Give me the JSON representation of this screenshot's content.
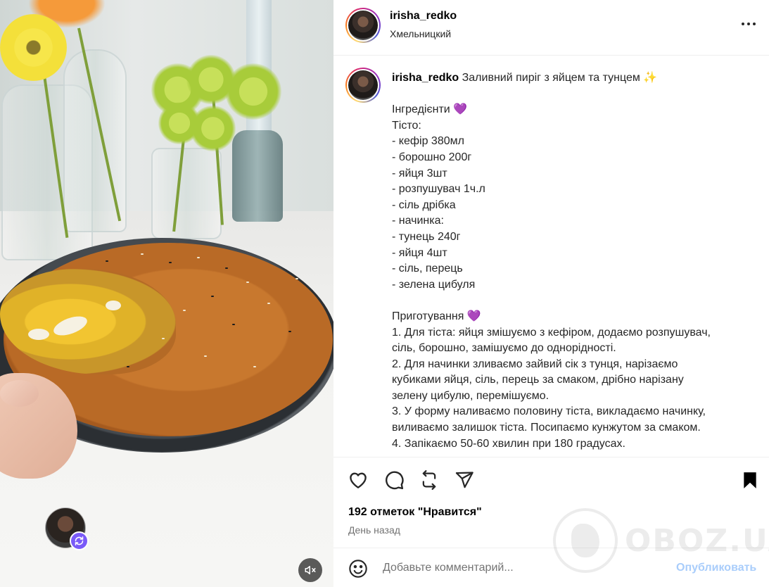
{
  "post": {
    "username": "irisha_redko",
    "location": "Хмельницкий"
  },
  "caption": {
    "username": "irisha_redko",
    "title": "Заливний пиріг з яйцем та тунцем ✨",
    "lines": [
      "Інгредієнти 💜",
      "Тісто:",
      "- кефір 380мл",
      "- борошно 200г",
      "- яйця 3шт",
      "- розпушувач 1ч.л",
      "- сіль дрібка",
      "- начинка:",
      "- тунець 240г",
      "- яйця 4шт",
      "- сіль, перець",
      "- зелена цибуля",
      "",
      "Приготування 💜",
      "1. Для тіста: яйця змішуємо з кефіром, додаємо розпушувач,",
      "сіль, борошно, замішуємо до однорідності.",
      "2. Для начинки зливаємо зайвий сік з тунця, нарізаємо",
      "кубиками яйця, сіль, перець за смаком, дрібно нарізану",
      "зелену цибулю, перемішуємо.",
      "3. У форму наливаємо половину тіста, викладаємо начинку,",
      "виливаємо залишок тіста. Посипаємо кунжутом за смаком.",
      "4. Запікаємо 50-60 хвилин при 180 градусах."
    ]
  },
  "stats": {
    "likes": "192 отметок \"Нравится\"",
    "time": "День назад"
  },
  "comment": {
    "placeholder": "Добавьте комментарий...",
    "publish_label": "Опубликовать"
  },
  "watermark": {
    "text": "OBOZ.UA"
  },
  "icons": {
    "like": "heart-icon",
    "comment": "comment-icon",
    "repost": "repost-icon",
    "share": "send-icon",
    "save": "bookmark-icon",
    "more": "more-icon",
    "emoji": "emoji-icon",
    "mute": "mute-icon"
  },
  "colors": {
    "publish_disabled": "#a9cdfb",
    "secondary_text": "#737373",
    "badge": "#7a5af8"
  }
}
